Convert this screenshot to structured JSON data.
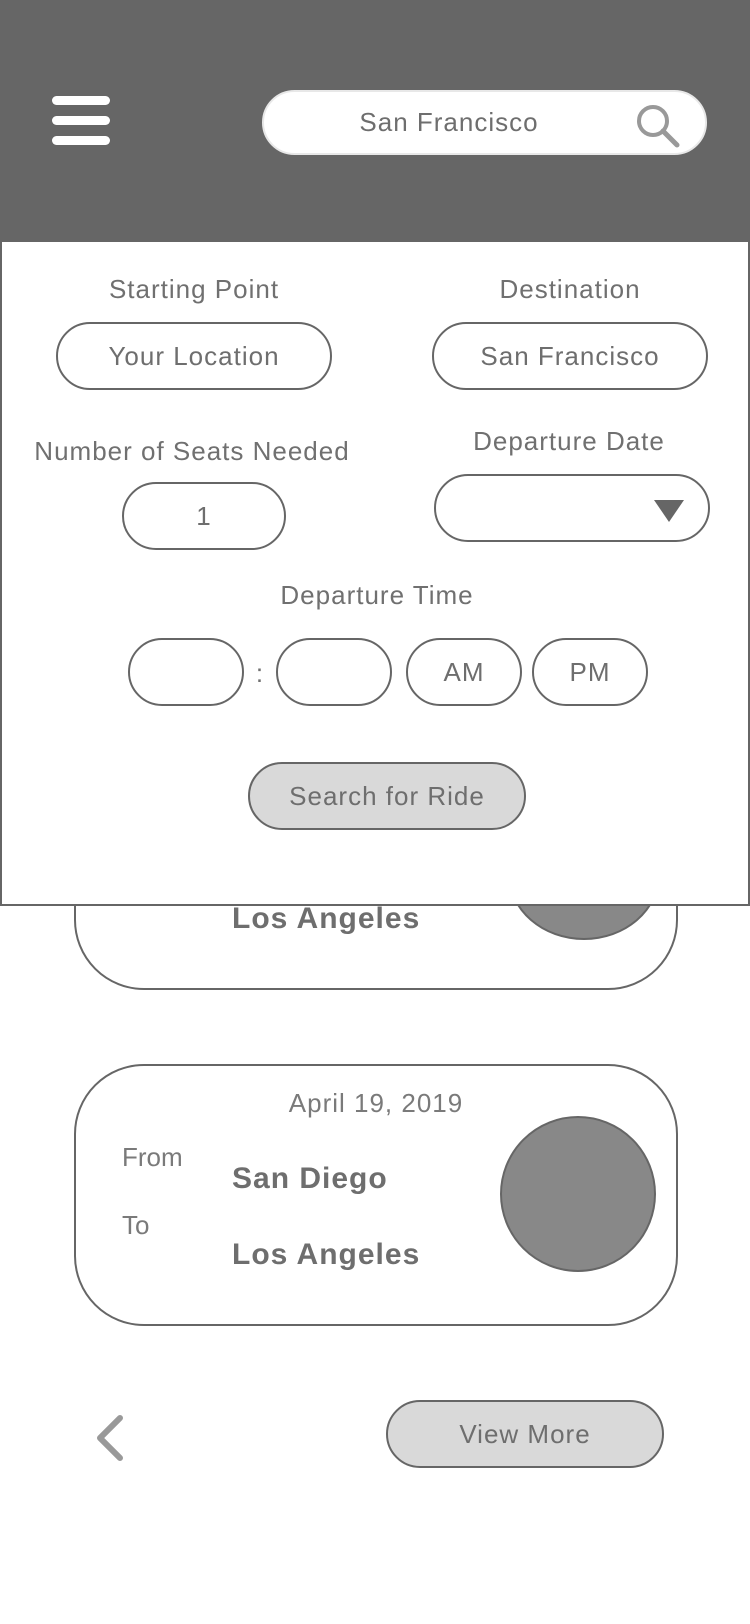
{
  "header": {
    "search": {
      "value": "San Francisco",
      "icon": "search-icon"
    },
    "menu_icon": "hamburger-menu-icon",
    "background": "#666666"
  },
  "form": {
    "starting_point": {
      "label": "Starting Point",
      "value": "Your Location"
    },
    "destination": {
      "label": "Destination",
      "value": "San Francisco"
    },
    "seats": {
      "label": "Number of Seats Needed",
      "value": "1"
    },
    "departure_date": {
      "label": "Departure Date",
      "value": ""
    },
    "departure_time": {
      "label": "Departure Time",
      "hour": "",
      "separator": ":",
      "minute": "",
      "am_label": "AM",
      "pm_label": "PM"
    },
    "search_button": "Search for Ride"
  },
  "rides": [
    {
      "to": "Los Angeles"
    },
    {
      "date": "April 19, 2019",
      "from_label": "From",
      "from": "San Diego",
      "to_label": "To",
      "to": "Los Angeles"
    }
  ],
  "footer": {
    "back_icon": "chevron-left-icon",
    "view_more": "View More"
  }
}
